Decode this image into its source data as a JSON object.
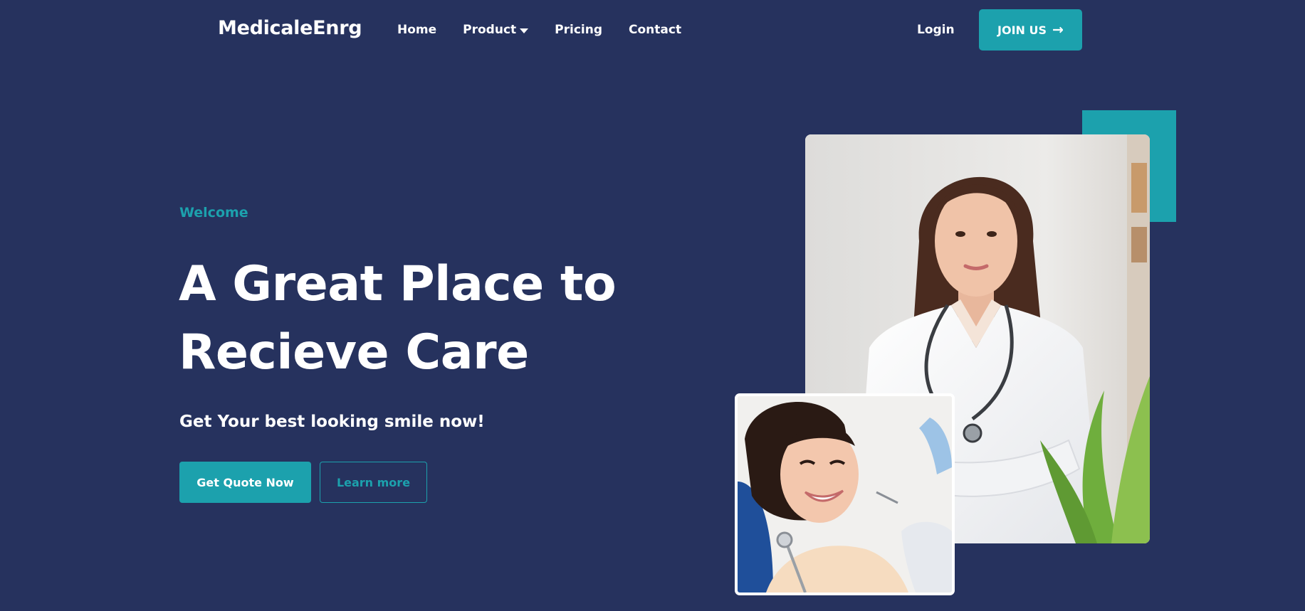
{
  "brand": {
    "logo_text": "MedicaleEnrg"
  },
  "nav": {
    "items": [
      {
        "label": "Home"
      },
      {
        "label": "Product"
      },
      {
        "label": "Pricing"
      },
      {
        "label": "Contact"
      }
    ],
    "login_label": "Login",
    "join_label": "JOIN US"
  },
  "hero": {
    "eyebrow": "Welcome",
    "headline_line1": "A Great Place to",
    "headline_line2": "Recieve Care",
    "subheadline": "Get Your best looking smile now!",
    "primary_button": "Get Quote Now",
    "secondary_button": "Learn more"
  },
  "icons": {
    "product_dropdown": "chevron-down-icon",
    "join_arrow": "arrow-right-icon"
  },
  "colors": {
    "background": "#26325e",
    "accent": "#1ca1ad",
    "text": "#ffffff"
  }
}
